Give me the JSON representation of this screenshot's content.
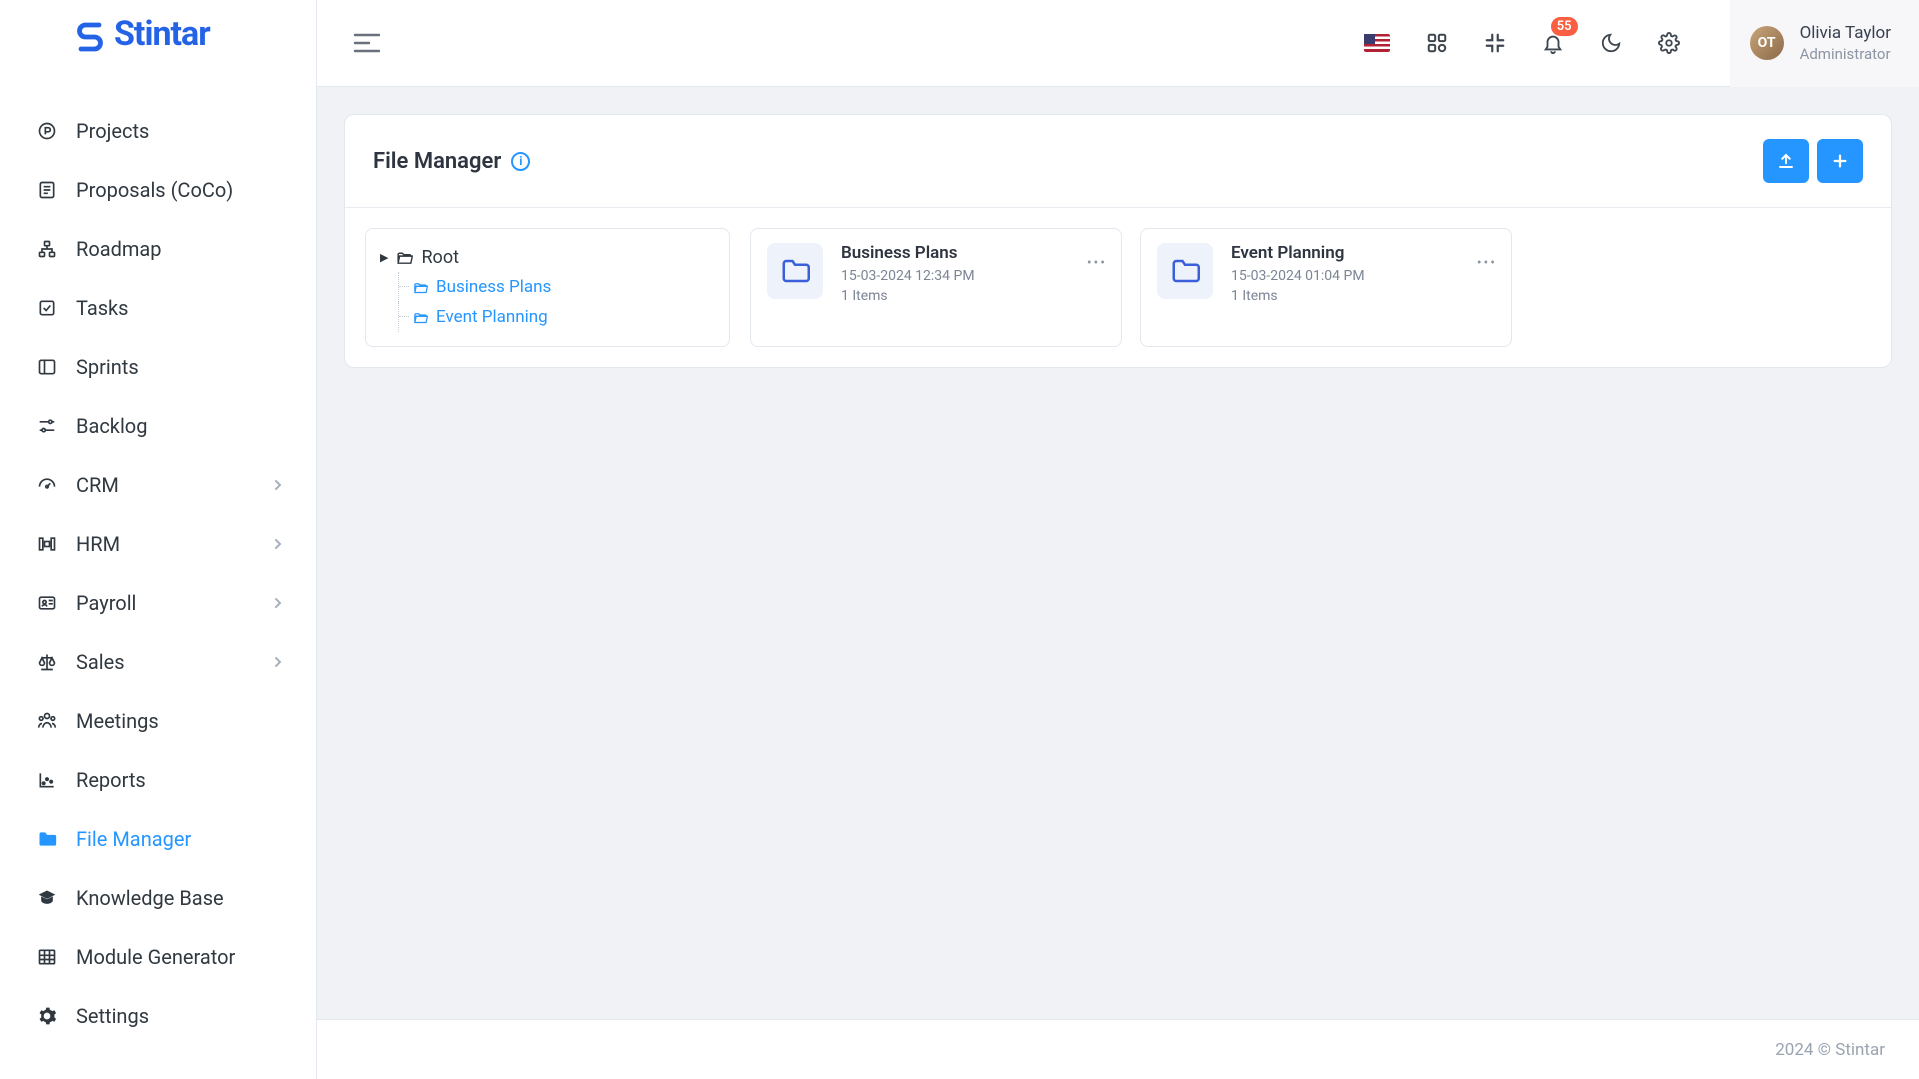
{
  "brand": "Stintar",
  "sidebar": {
    "items": [
      {
        "label": "Projects",
        "icon": "circle-p",
        "chevron": false,
        "active": false
      },
      {
        "label": "Proposals (CoCo)",
        "icon": "doc",
        "chevron": false,
        "active": false
      },
      {
        "label": "Roadmap",
        "icon": "sitemap",
        "chevron": false,
        "active": false
      },
      {
        "label": "Tasks",
        "icon": "task",
        "chevron": false,
        "active": false
      },
      {
        "label": "Sprints",
        "icon": "panel",
        "chevron": false,
        "active": false
      },
      {
        "label": "Backlog",
        "icon": "sliders",
        "chevron": false,
        "active": false
      },
      {
        "label": "CRM",
        "icon": "gauge",
        "chevron": true,
        "active": false
      },
      {
        "label": "HRM",
        "icon": "hrm",
        "chevron": true,
        "active": false
      },
      {
        "label": "Payroll",
        "icon": "id",
        "chevron": true,
        "active": false
      },
      {
        "label": "Sales",
        "icon": "scale",
        "chevron": true,
        "active": false
      },
      {
        "label": "Meetings",
        "icon": "people",
        "chevron": false,
        "active": false
      },
      {
        "label": "Reports",
        "icon": "chart",
        "chevron": false,
        "active": false
      },
      {
        "label": "File Manager",
        "icon": "folder",
        "chevron": false,
        "active": true
      },
      {
        "label": "Knowledge Base",
        "icon": "grad",
        "chevron": false,
        "active": false
      },
      {
        "label": "Module Generator",
        "icon": "grid",
        "chevron": false,
        "active": false
      },
      {
        "label": "Settings",
        "icon": "gear",
        "chevron": false,
        "active": false
      }
    ]
  },
  "topbar": {
    "notification_count": "55"
  },
  "user": {
    "name": "Olivia Taylor",
    "role": "Administrator",
    "initials": "OT"
  },
  "page": {
    "title": "File Manager"
  },
  "tree": {
    "root_label": "Root",
    "children": [
      {
        "label": "Business Plans"
      },
      {
        "label": "Event Planning"
      }
    ]
  },
  "folders": [
    {
      "name": "Business Plans",
      "timestamp": "15-03-2024 12:34 PM",
      "items": "1 Items"
    },
    {
      "name": "Event Planning",
      "timestamp": "15-03-2024 01:04 PM",
      "items": "1 Items"
    }
  ],
  "footer": "2024 © Stintar"
}
